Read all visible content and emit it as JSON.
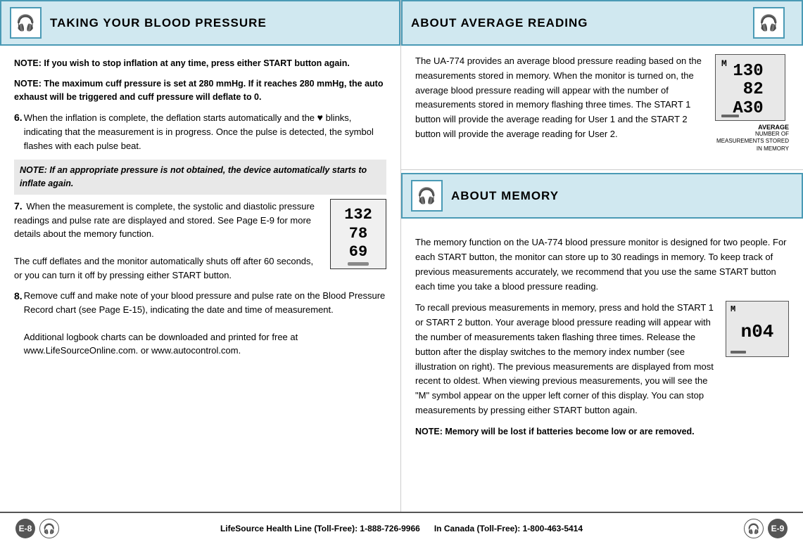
{
  "left": {
    "header": {
      "title": "TAKING YOUR BLOOD PRESSURE",
      "icon": "🎧"
    },
    "note1": "NOTE: If you wish to stop inflation at any time, press either START button again.",
    "note2": "NOTE: The maximum cuff pressure is set at 280 mmHg. If it reaches 280 mmHg, the auto exhaust will be triggered and cuff pressure will deflate to 0.",
    "step6_num": "6.",
    "step6_text": "When the inflation is complete, the deflation starts automatically and the ♥ blinks, indicating that the measurement is in progress. Once the pulse is detected, the symbol flashes with each pulse beat.",
    "step6_note": "NOTE: If an appropriate pressure is not obtained, the device automatically starts to inflate again.",
    "step7_num": "7.",
    "step7_line1": "When the measurement is complete, the systolic and diastolic pressure readings and pulse rate are displayed and stored. See Page E-9 for more details about the memory function.",
    "step7_line2": "The cuff deflates and the monitor automatically shuts off after 60 seconds, or you can turn it off by pressing either START button.",
    "device_top": "132",
    "device_mid": "78",
    "device_bot": "69",
    "step8_num": "8.",
    "step8_line1": "Remove cuff and make note of your blood pressure and pulse rate on the Blood Pressure Record chart (see Page E-15), indicating the date and time of measurement.",
    "step8_line2": "Additional logbook charts can be downloaded and printed for free at www.LifeSourceOnline.com. or www.autocontrol.com."
  },
  "right": {
    "avg_header": {
      "title": "ABOUT AVERAGE READING",
      "icon": "🎧"
    },
    "avg_text": "The UA-774 provides an average blood pressure reading based on the measurements stored in memory. When the monitor is turned on, the average blood pressure reading will appear with the number of measurements stored in memory flashing three times.  The START 1 button will provide the average reading for User 1 and the START 2 button will provide the average reading for User 2.",
    "avg_device_m": "M",
    "avg_device_line1": "130",
    "avg_device_line2": "82",
    "avg_device_line3": "A30",
    "avg_label": "AVERAGE",
    "num_label": "NUMBER OF MEASUREMENTS STORED IN MEMORY",
    "memory_header": {
      "title": "ABOUT MEMORY",
      "icon": "🎧"
    },
    "memory_text1": "The memory function on the UA-774 blood pressure monitor is designed for two people. For each START button, the monitor can store up to 30 readings in memory. To keep track of previous measurements accurately, we recommend that you use the same START button each time you take a blood pressure reading.",
    "recall_text": "To recall previous measurements in memory, press and hold the START 1 or START 2 button. Your average blood pressure reading will appear with the number of measurements taken flashing three times. Release the button after the display switches to the memory index number (see illustration on right). The previous measurements are displayed from most recent to oldest. When viewing previous measurements, you will see the \"M\" symbol appear on the upper left corner of this display. You can stop measurements by pressing either START button again.",
    "recall_device_m": "M",
    "recall_device_num": "n04",
    "note_memory": "NOTE: Memory will be lost if batteries become low or are removed."
  },
  "footer": {
    "page_left": "E-8",
    "lifesource_label": "LifeSource Health Line (Toll-Free): 1-888-726-9966",
    "canada_label": "In Canada (Toll-Free): 1-800-463-5414",
    "page_right": "E-9"
  }
}
